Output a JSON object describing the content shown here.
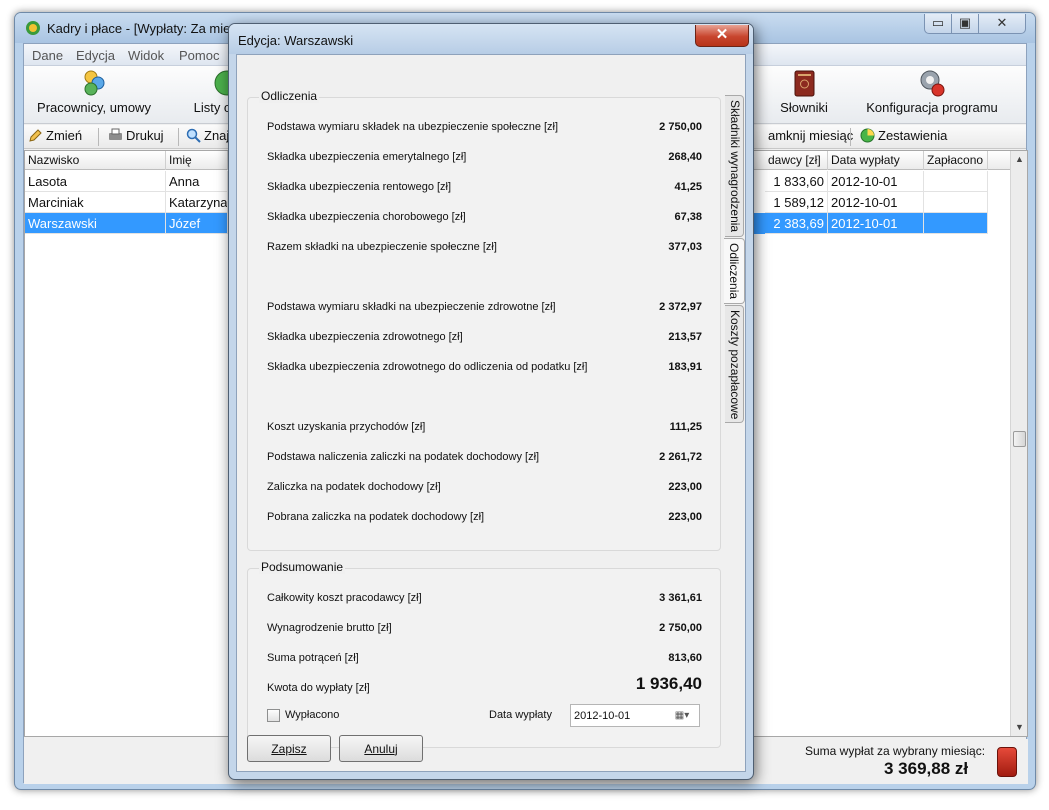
{
  "main": {
    "title": "Kadry i płace - [Wypłaty: Za mie",
    "window_buttons": {
      "minimize": "▭",
      "maximize": "▣",
      "close": "✕"
    }
  },
  "menu": [
    "Dane",
    "Edycja",
    "Widok",
    "Pomoc"
  ],
  "big_toolbar": {
    "employees": "Pracownicy, umowy",
    "lists": "Listy ob",
    "dictionaries": "Słowniki",
    "config": "Konfiguracja programu"
  },
  "small_toolbar": {
    "change": "Zmień",
    "print": "Drukuj",
    "find": "Znaj",
    "close_month": "amknij miesiąc",
    "summary": "Zestawienia"
  },
  "grid": {
    "columns": {
      "surname": "Nazwisko",
      "name": "Imię",
      "cost": "dawcy [zł]",
      "date": "Data wypłaty",
      "paid": "Zapłacono"
    },
    "rows": [
      {
        "surname": "Lasota",
        "name": "Anna",
        "cost": "1 833,60",
        "date": "2012-10-01",
        "paid": ""
      },
      {
        "surname": "Marciniak",
        "name": "Katarzyna",
        "cost": "1 589,12",
        "date": "2012-10-01",
        "paid": ""
      },
      {
        "surname": "Warszawski",
        "name": "Józef",
        "cost": "2 383,69",
        "date": "2012-10-01",
        "paid": ""
      }
    ],
    "scroll_up": "▲",
    "scroll_down": "▼"
  },
  "status": {
    "label": "Suma wypłat za wybrany miesiąc:",
    "total": "3 369,88  zł"
  },
  "dialog": {
    "title": "Edycja: Warszawski",
    "close_symbol": "✕",
    "tabs": [
      "Składniki wynagrodzenia",
      "Odliczenia",
      "Koszty pozapłacowe"
    ],
    "deductions": {
      "legend": "Odliczenia",
      "rows": [
        {
          "label": "Podstawa wymiaru składek na ubezpieczenie społeczne [zł]",
          "value": "2 750,00"
        },
        {
          "label": "Składka ubezpieczenia emerytalnego [zł]",
          "value": "268,40"
        },
        {
          "label": "Składka ubezpieczenia rentowego [zł]",
          "value": "41,25"
        },
        {
          "label": "Składka ubezpieczenia chorobowego [zł]",
          "value": "67,38"
        },
        {
          "label": "Razem składki na ubezpieczenie społeczne [zł]",
          "value": "377,03"
        },
        {
          "label": "Podstawa wymiaru składki na ubezpieczenie zdrowotne [zł]",
          "value": "2 372,97"
        },
        {
          "label": "Składka ubezpieczenia zdrowotnego [zł]",
          "value": "213,57"
        },
        {
          "label": "Składka ubezpieczenia zdrowotnego do odliczenia od podatku [zł]",
          "value": "183,91"
        },
        {
          "label": "Koszt uzyskania przychodów [zł]",
          "value": "111,25"
        },
        {
          "label": "Podstawa naliczenia zaliczki na podatek dochodowy [zł]",
          "value": "2 261,72"
        },
        {
          "label": "Zaliczka na podatek dochodowy [zł]",
          "value": "223,00"
        },
        {
          "label": "Pobrana zaliczka na podatek dochodowy [zł]",
          "value": "223,00"
        }
      ]
    },
    "summary": {
      "legend": "Podsumowanie",
      "rows": [
        {
          "label": "Całkowity koszt pracodawcy [zł]",
          "value": "3 361,61"
        },
        {
          "label": "Wynagrodzenie brutto [zł]",
          "value": "2 750,00"
        },
        {
          "label": "Suma potrąceń [zł]",
          "value": "813,60"
        },
        {
          "label": "Kwota do wypłaty [zł]",
          "value": "1 936,40"
        }
      ],
      "paid_label": "Wypłacono",
      "paid_checked": false,
      "date_label": "Data wypłaty",
      "date_value": "2012-10-01",
      "date_dropdown": "▦▾"
    },
    "buttons": {
      "save": "Zapisz",
      "cancel": "Anuluj"
    }
  }
}
